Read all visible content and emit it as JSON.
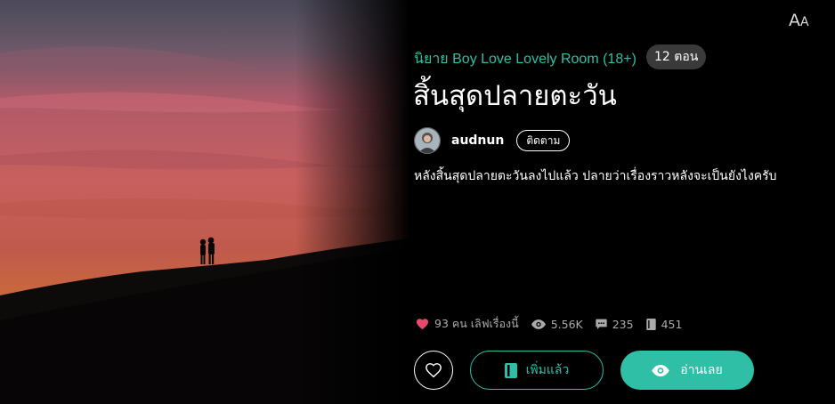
{
  "header": {
    "font_toggle_label": "AA"
  },
  "novel": {
    "category": "นิยาย Boy Love Lovely Room (18+)",
    "episodes_badge": "12 ตอน",
    "title": "สิ้นสุดปลายตะวัน",
    "synopsis": "หลังสิ้นสุดปลายตะวันลงไปแล้ว ปลายว่าเรื่องราวหลังจะเป็นยังไงครับ"
  },
  "author": {
    "name": "audnun",
    "follow_label": "ติดตาม"
  },
  "stats": {
    "likes_text": "93 คน เลิฟเรื่องนี้",
    "views": "5.56K",
    "comments": "235",
    "chapters": "451"
  },
  "actions": {
    "add_label": "เพิ่มแล้ว",
    "read_label": "อ่านเลย"
  },
  "colors": {
    "accent": "#2fbfa7",
    "heart": "#e8476e",
    "background": "#000000"
  },
  "icons": {
    "font_toggle": "font-size-icon",
    "heart": "heart-icon",
    "views": "eye-icon",
    "comments": "comment-icon",
    "chapters": "book-icon",
    "favorite": "heart-outline-icon",
    "add": "bookmark-icon",
    "read": "eye-icon"
  }
}
